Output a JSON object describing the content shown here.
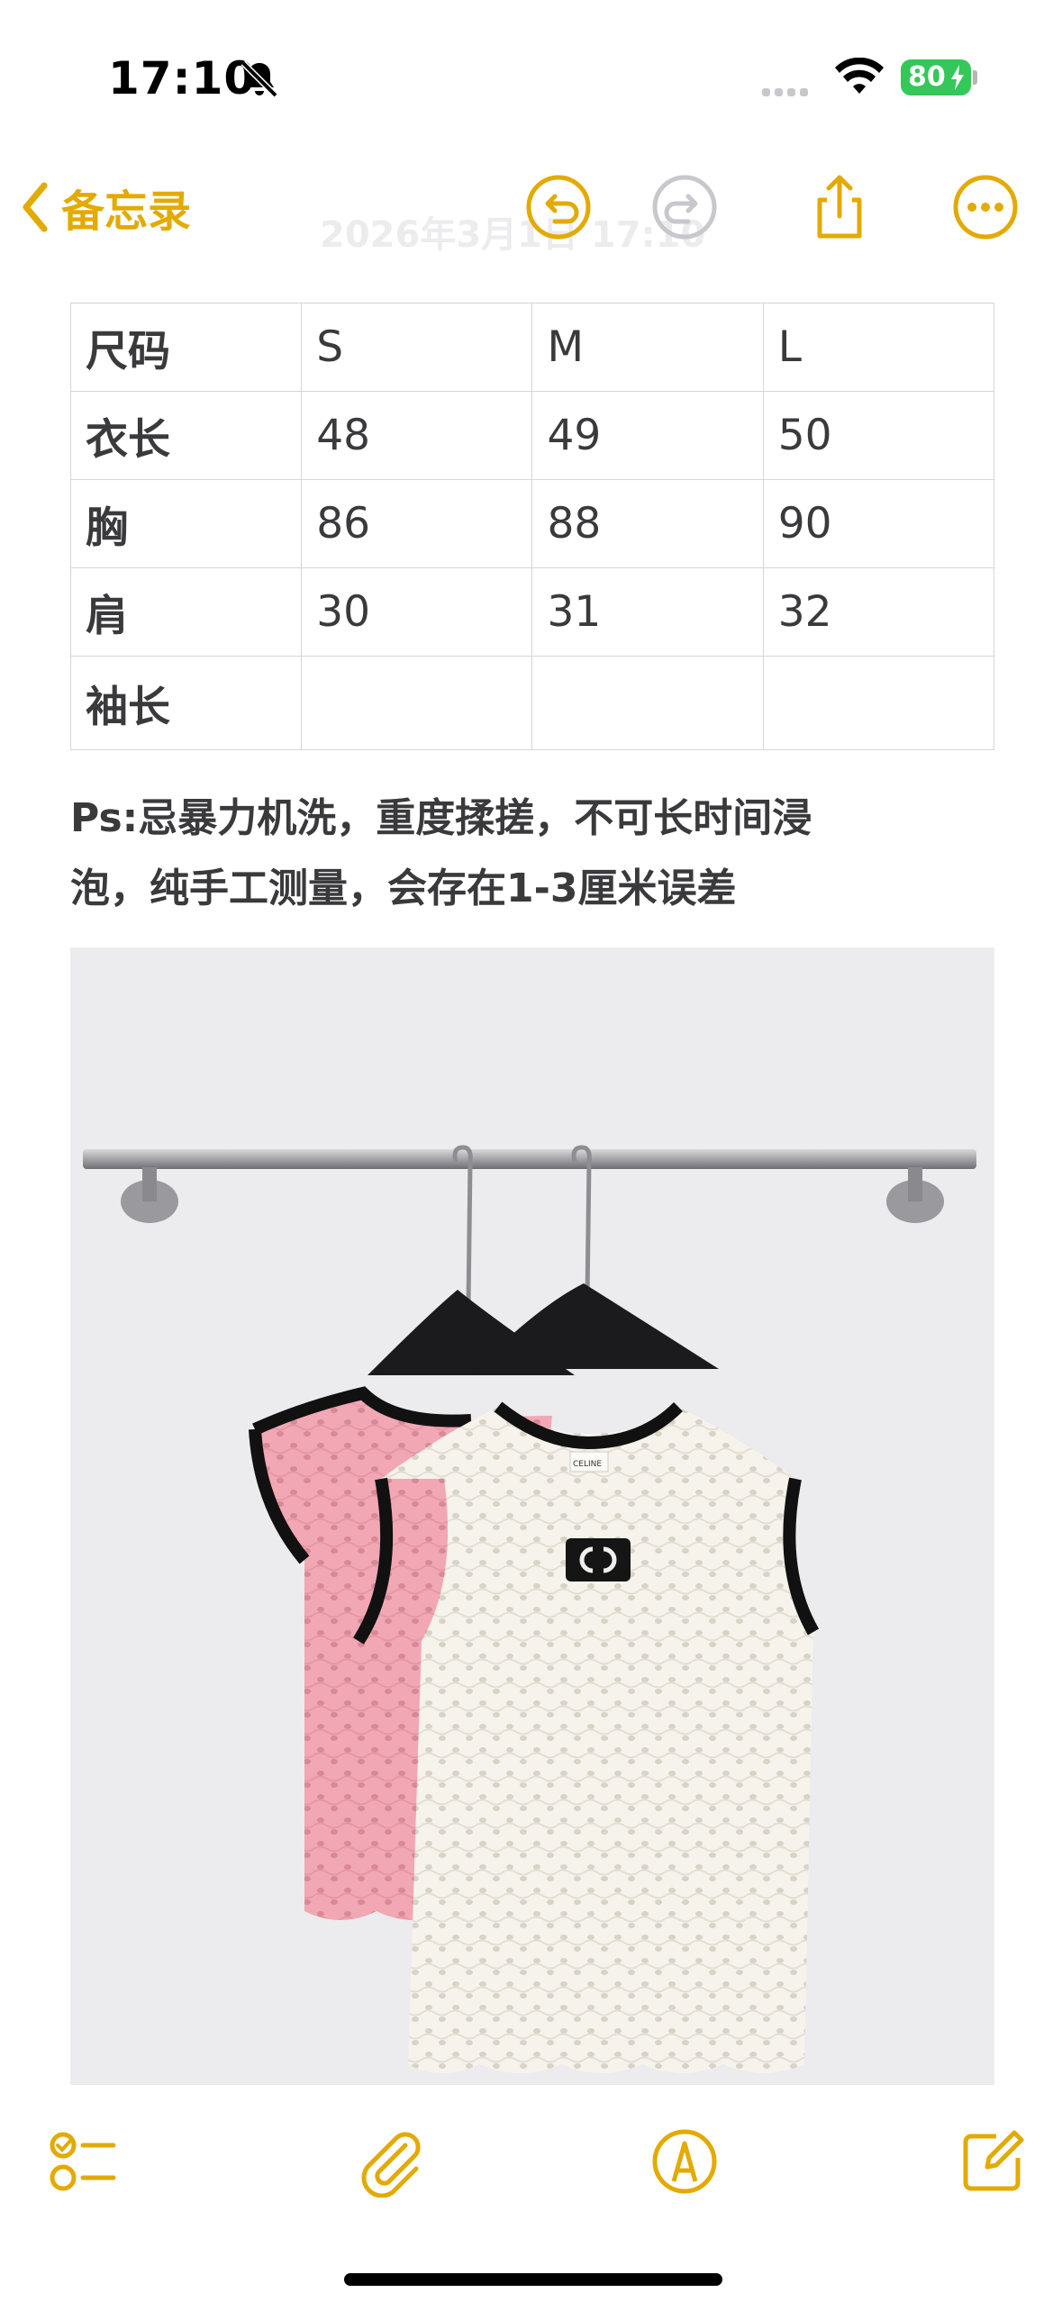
{
  "status_bar": {
    "time": "17:10",
    "battery": "80",
    "icons": [
      "silent-bell-icon",
      "cellular-signal-icon",
      "wifi-icon",
      "battery-charging-icon"
    ]
  },
  "nav": {
    "back_label": "备忘录",
    "date_ghost": "2026年3月1日 17:10",
    "icons": [
      "chevron-left-icon",
      "undo-icon",
      "redo-icon",
      "share-icon",
      "more-icon"
    ]
  },
  "table": {
    "rows": [
      [
        "尺码",
        "S",
        "M",
        "L"
      ],
      [
        "衣长",
        "48",
        "49",
        "50"
      ],
      [
        "胸",
        "86",
        "88",
        "90"
      ],
      [
        "肩",
        "30",
        "31",
        "32"
      ],
      [
        "袖长",
        "",
        "",
        ""
      ]
    ]
  },
  "note": {
    "line1": "Ps:忌暴力机洗，重度揉搓，不可长时间浸",
    "line2": "泡，纯手工测量，会存在1-3厘米误差"
  },
  "photo": {
    "brand_label": "CELINE",
    "description_icon": "product-photo"
  },
  "toolbar": {
    "icons": [
      "checklist-icon",
      "attachment-icon",
      "markup-icon",
      "compose-icon"
    ]
  },
  "colors": {
    "accent": "#e3aa00",
    "battery": "#34c759",
    "disabled": "#c7c7cc"
  }
}
